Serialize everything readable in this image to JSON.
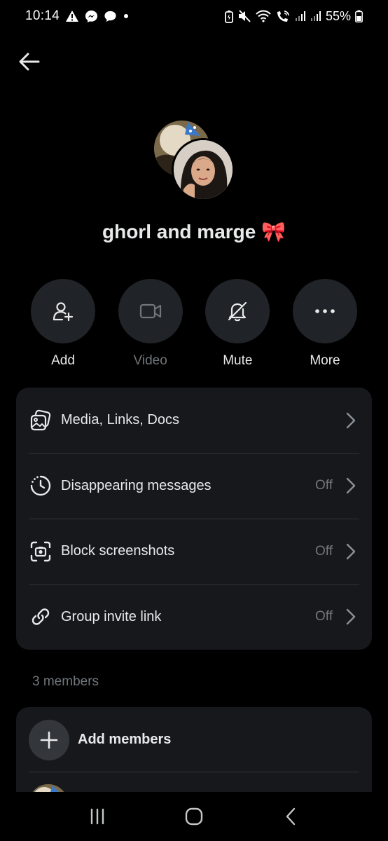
{
  "status_bar": {
    "time": "10:14",
    "battery": "55%",
    "left_icons": [
      "alert-icon",
      "messenger-icon",
      "chat-icon",
      "dot-icon"
    ],
    "right_icons": [
      "battery-saver-icon",
      "mute-icon",
      "wifi-icon",
      "wifi-calling-icon",
      "signal-icon",
      "signal-icon",
      "battery-icon"
    ]
  },
  "header": {
    "back_icon": "arrow-left-icon"
  },
  "group": {
    "title": "ghorl and marge 🎀"
  },
  "actions": [
    {
      "label": "Add",
      "icon": "add-person-icon",
      "enabled": true
    },
    {
      "label": "Video",
      "icon": "video-icon",
      "enabled": false
    },
    {
      "label": "Mute",
      "icon": "bell-off-icon",
      "enabled": true
    },
    {
      "label": "More",
      "icon": "more-icon",
      "enabled": true
    }
  ],
  "settings": [
    {
      "label": "Media, Links, Docs",
      "value": "",
      "icon": "media-icon"
    },
    {
      "label": "Disappearing messages",
      "value": "Off",
      "icon": "timer-icon"
    },
    {
      "label": "Block screenshots",
      "value": "Off",
      "icon": "screenshot-icon"
    },
    {
      "label": "Group invite link",
      "value": "Off",
      "icon": "link-icon"
    }
  ],
  "members": {
    "count_label": "3 members",
    "add_label": "Add members"
  },
  "colors": {
    "background": "#000000",
    "card": "#16181c",
    "button": "#202327",
    "text": "#e7e9ea",
    "muted": "#71767b"
  }
}
